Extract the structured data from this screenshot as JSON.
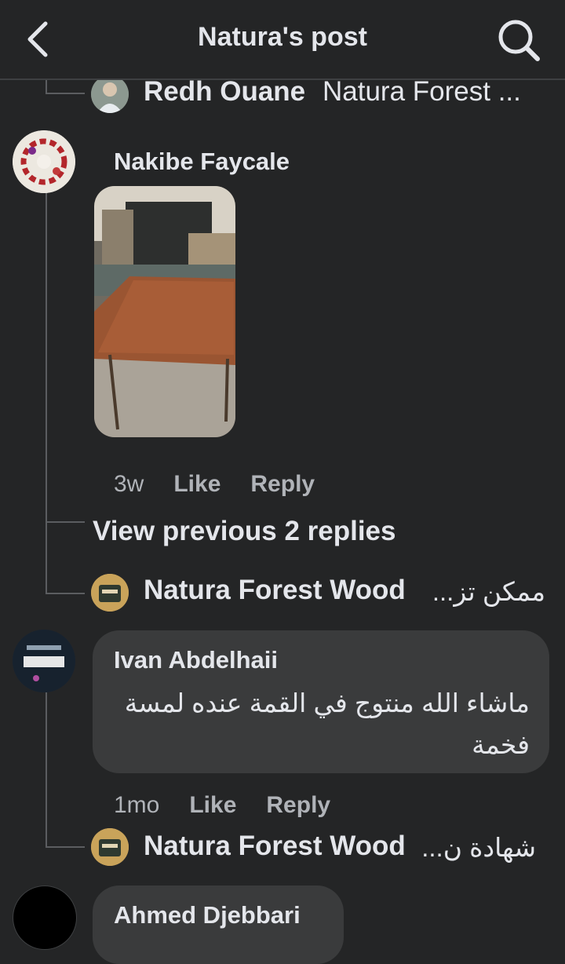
{
  "header": {
    "title": "Natura's post",
    "back_icon": "back-arrow-icon",
    "search_icon": "search-icon"
  },
  "reply_top": {
    "author": "Redh Ouane",
    "snippet": "Natura Forest ..."
  },
  "comment1": {
    "author": "Nakibe Faycale",
    "time": "3w",
    "like": "Like",
    "reply": "Reply",
    "view_previous": "View previous 2 replies"
  },
  "reply1": {
    "author": "Natura Forest Wood",
    "snippet": "ممكن تز..."
  },
  "comment2": {
    "author": "Ivan Abdelhaii",
    "text": "ماشاء الله منتوج  في القمة عنده لمسة فخمة",
    "time": "1mo",
    "like": "Like",
    "reply": "Reply"
  },
  "reply2": {
    "author": "Natura Forest Wood",
    "snippet": "شهادة ن..."
  },
  "comment3": {
    "author": "Ahmed Djebbari"
  },
  "colors": {
    "background": "#242526",
    "bubble": "#3a3b3c",
    "text": "#e4e6eb",
    "muted": "#b0b3b8"
  }
}
